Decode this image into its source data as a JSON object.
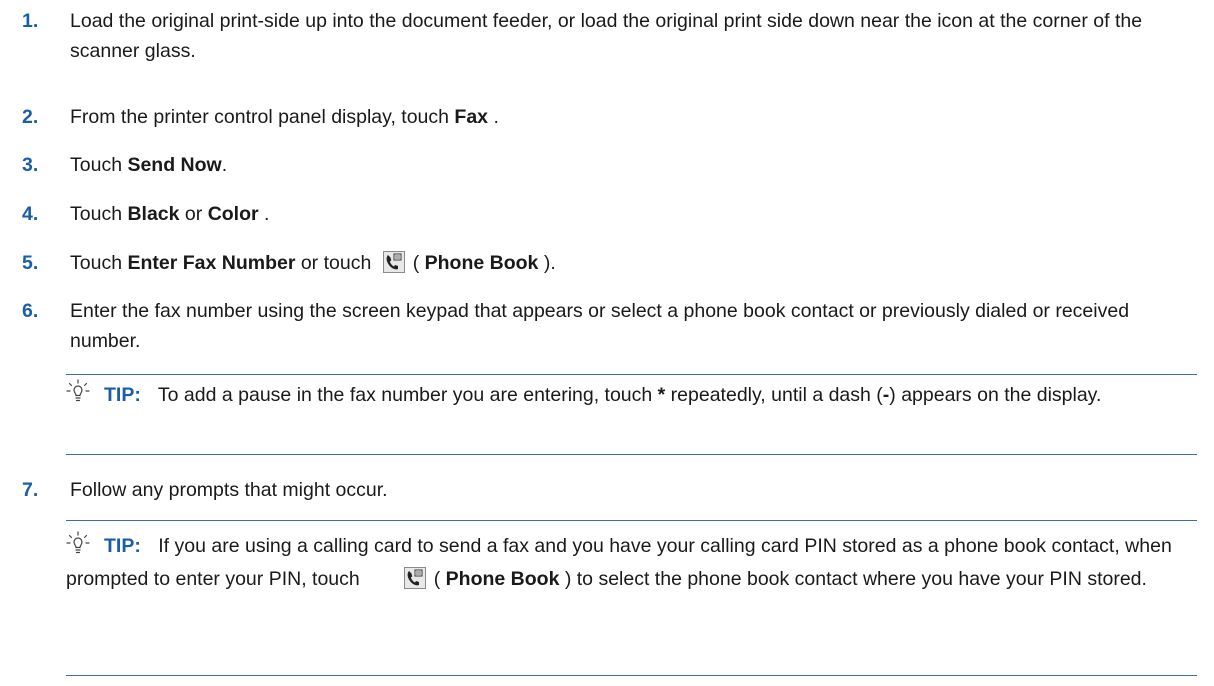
{
  "steps": [
    {
      "num": "1.",
      "text": "Load the original print-side up into the document feeder, or load the original print side down near the icon at the corner of the scanner glass."
    },
    {
      "num": "2.",
      "pre": "From the printer control panel display, touch ",
      "bold": "Fax",
      "post": " ."
    },
    {
      "num": "3.",
      "pre": "Touch ",
      "bold": "Send Now",
      "post": "."
    },
    {
      "num": "4.",
      "pre": "Touch ",
      "bold1": "Black",
      "mid": " or ",
      "bold2": "Color",
      "post": " ."
    },
    {
      "num": "5.",
      "pre": "Touch ",
      "bold1": "Enter Fax Number",
      "mid": " or touch ",
      "paren_open": "( ",
      "bold2": "Phone Book",
      "post": " )."
    },
    {
      "num": "6.",
      "text": "Enter the fax number using the screen keypad that appears or select a phone book contact or previously dialed or received number."
    },
    {
      "num": "7.",
      "text": "Follow any prompts that might occur."
    }
  ],
  "tips": [
    {
      "label": "TIP:",
      "pre": "To add a pause in the fax number you are entering, touch ",
      "star": "*",
      "mid": " repeatedly, until a dash (",
      "dash": "-",
      "post": ") appears on the display."
    },
    {
      "label": "TIP:",
      "pre": "If you are using a calling card to send a fax and you have your calling card PIN stored as a phone book contact, when prompted to enter your PIN, touch",
      "paren_open": "( ",
      "bold": "Phone Book",
      "post": " ) to select the phone book contact where you have your PIN stored."
    }
  ],
  "icons": {
    "tip": "lightbulb-icon",
    "phone_book": "phone-book-icon"
  },
  "colors": {
    "accent": "#1a5ea8",
    "rule": "#3b6ea5"
  }
}
